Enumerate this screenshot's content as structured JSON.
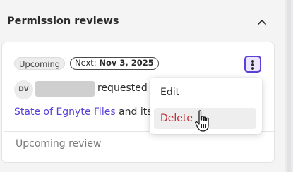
{
  "section": {
    "title": "Permission reviews",
    "collapse_icon": "chevron-up-icon"
  },
  "card": {
    "status_badge": "Upcoming",
    "next_badge": {
      "label": "Next:",
      "date": "Nov 3, 2025"
    },
    "menu_icon": "kebab-menu-icon",
    "requester": {
      "avatar_initials": "DV",
      "action_text": "requested"
    },
    "resource": {
      "link_text": "State of Egnyte Files",
      "suffix_text": "and its"
    },
    "review_status": "Upcoming review"
  },
  "menu": {
    "items": [
      {
        "label": "Edit"
      },
      {
        "label": "Delete"
      }
    ]
  },
  "colors": {
    "accent": "#5b3fd6",
    "danger": "#c0282f",
    "background": "#f4f4f5"
  }
}
